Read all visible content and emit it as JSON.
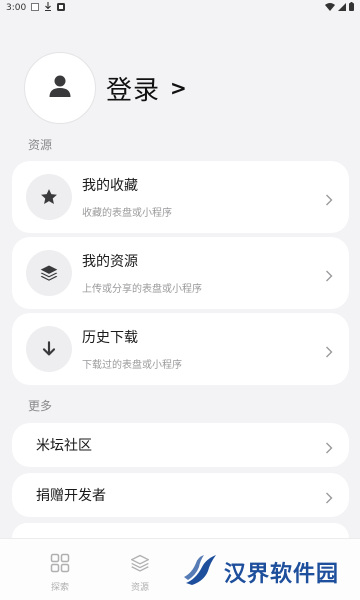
{
  "status_bar": {
    "time": "3:00",
    "icons": [
      "notification-square-icon",
      "download-icon",
      "app-notification-icon",
      "wifi-icon",
      "signal-icon",
      "battery-icon"
    ]
  },
  "profile": {
    "login_label": "登录",
    "arrow": ">",
    "icon": "user-icon"
  },
  "sections": {
    "resources_label": "资源",
    "more_label": "更多"
  },
  "resource_cards": [
    {
      "title": "我的收藏",
      "subtitle": "收藏的表盘或小程序",
      "icon": "star-icon"
    },
    {
      "title": "我的资源",
      "subtitle": "上传或分享的表盘或小程序",
      "icon": "layers-icon"
    },
    {
      "title": "历史下载",
      "subtitle": "下载过的表盘或小程序",
      "icon": "download-arrow-icon"
    }
  ],
  "more_items": [
    {
      "title": "米坛社区"
    },
    {
      "title": "捐赠开发者"
    }
  ],
  "bottom_nav": [
    {
      "label": "探索",
      "icon": "explore-grid-icon"
    },
    {
      "label": "资源",
      "icon": "layers-icon"
    }
  ],
  "watermark": {
    "text": "汉界软件园"
  },
  "colors": {
    "background": "#f3f3f5",
    "card": "#ffffff",
    "watermark": "#1e4f9c"
  }
}
